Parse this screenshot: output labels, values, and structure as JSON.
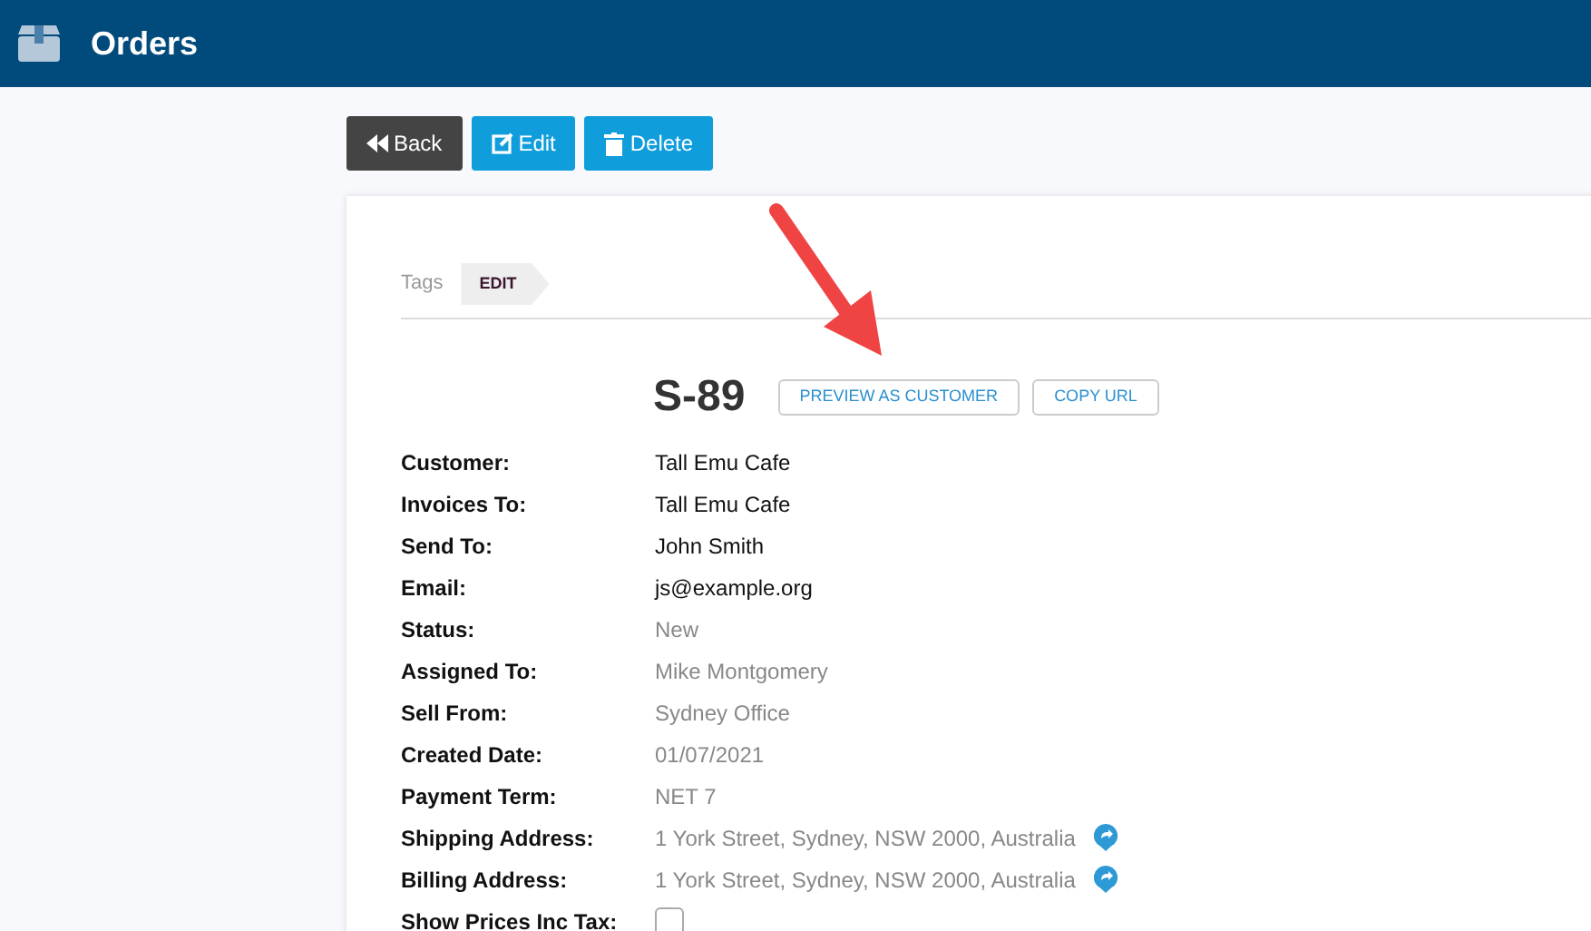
{
  "header": {
    "title": "Orders"
  },
  "actions": [
    {
      "label": "Back",
      "kind": "back"
    },
    {
      "label": "Edit",
      "kind": "edit"
    },
    {
      "label": "Delete",
      "kind": "delete"
    }
  ],
  "tags": {
    "label": "Tags",
    "tag": "EDIT"
  },
  "order": {
    "number": "S-89",
    "buttons": [
      "PREVIEW AS CUSTOMER",
      "COPY URL"
    ]
  },
  "fields": [
    {
      "label": "Customer:",
      "value": "Tall Emu Cafe",
      "kind": "text"
    },
    {
      "label": "Invoices To:",
      "value": "Tall Emu Cafe",
      "kind": "text"
    },
    {
      "label": "Send To:",
      "value": "John Smith",
      "kind": "text"
    },
    {
      "label": "Email:",
      "value": "js@example.org",
      "kind": "text"
    },
    {
      "label": "Status:",
      "value": "New",
      "kind": "readonly"
    },
    {
      "label": "Assigned To:",
      "value": "Mike Montgomery",
      "kind": "readonly"
    },
    {
      "label": "Sell From:",
      "value": "Sydney Office",
      "kind": "readonly"
    },
    {
      "label": "Created Date:",
      "value": "01/07/2021",
      "kind": "readonly"
    },
    {
      "label": "Payment Term:",
      "value": "NET 7",
      "kind": "readonly"
    },
    {
      "label": "Shipping Address:",
      "value": "1 York Street, Sydney, NSW 2000, Australia",
      "kind": "address"
    },
    {
      "label": "Billing Address:",
      "value": "1 York Street, Sydney, NSW 2000, Australia",
      "kind": "address"
    },
    {
      "label": "Show Prices Inc Tax:",
      "kind": "checkbox",
      "checked": false
    }
  ]
}
